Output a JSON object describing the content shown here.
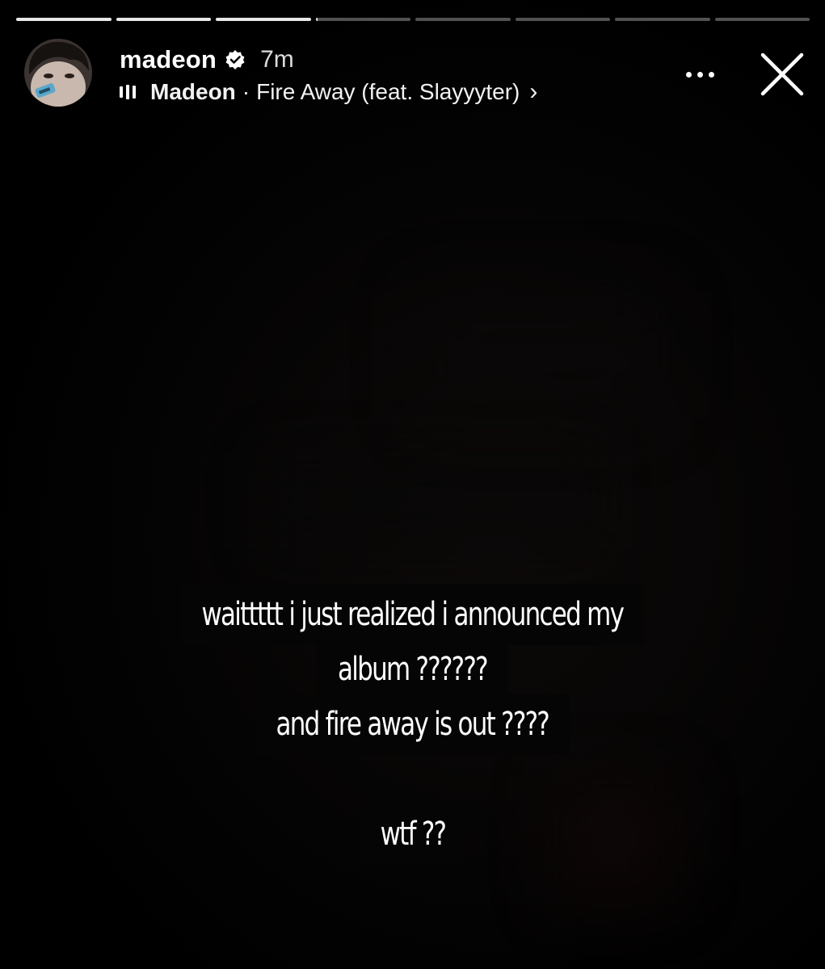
{
  "story": {
    "progress_segments": [
      1,
      1,
      1,
      0.02,
      0,
      0,
      0,
      0
    ],
    "progress_colors": {
      "done": "#e8e8e8",
      "pending": "rgba(255,255,255,0.32)"
    }
  },
  "header": {
    "username": "madeon",
    "verified": true,
    "timestamp": "7m",
    "music": {
      "artist": "Madeon",
      "separator": "·",
      "track": "Fire Away (feat. Slayyyter)",
      "chevron": "›"
    },
    "icons": {
      "avatar": "profile-avatar",
      "verified": "verified-badge-icon",
      "music": "music-bars-icon",
      "more": "more-dots-icon",
      "close": "close-icon"
    }
  },
  "caption": {
    "line1": "waittttt i just realized i announced my",
    "line2": "album ??????",
    "line3": "and fire away is out ????",
    "line4": "wtf ??"
  }
}
